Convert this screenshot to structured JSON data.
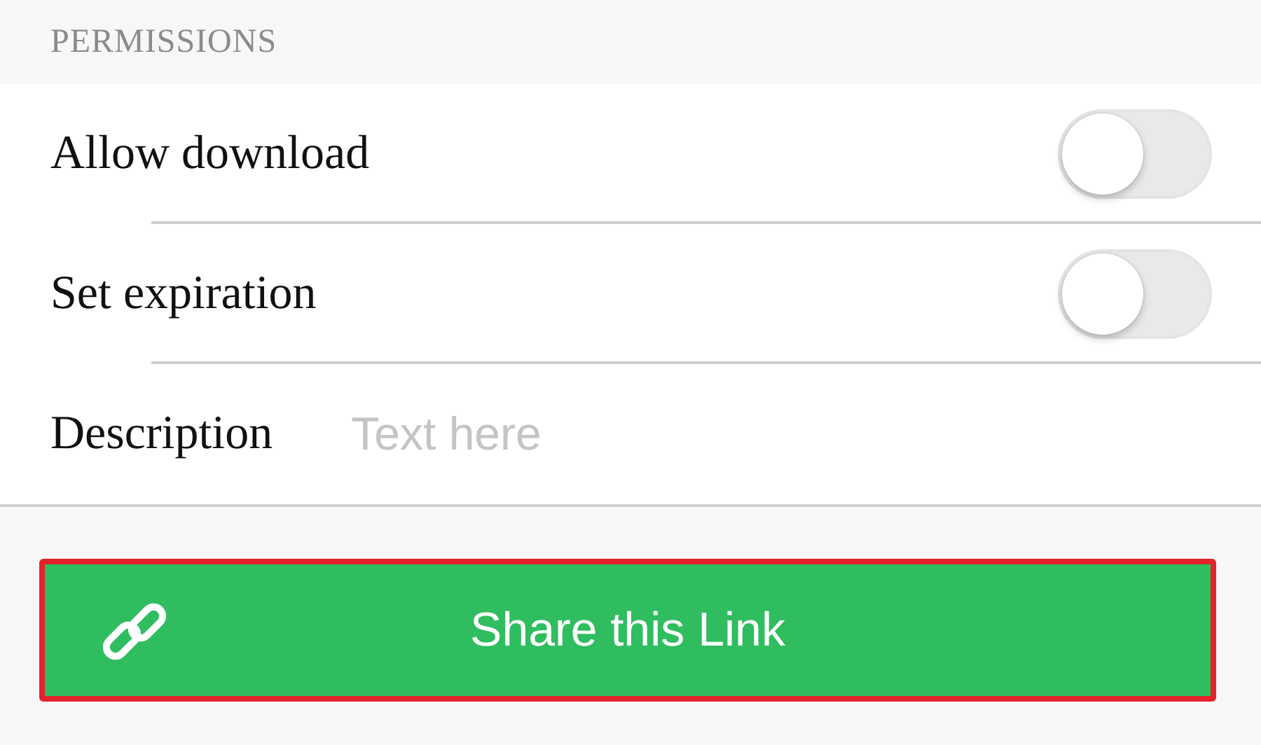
{
  "section_title": "PERMISSIONS",
  "rows": [
    {
      "kind": "toggle",
      "label": "Allow download",
      "on": false
    },
    {
      "kind": "toggle",
      "label": "Set expiration",
      "on": false
    },
    {
      "kind": "field",
      "label": "Description",
      "placeholder": "Text here"
    }
  ],
  "share_button": {
    "label": "Share this Link"
  }
}
